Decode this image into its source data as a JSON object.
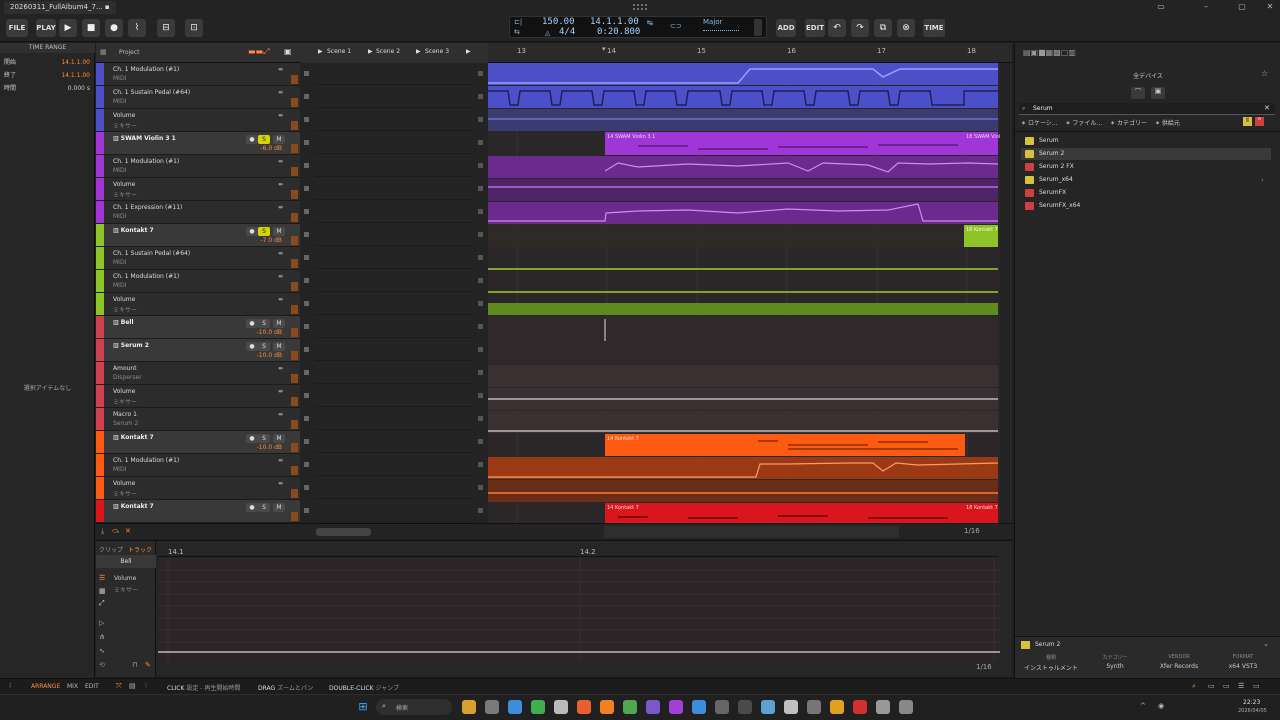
{
  "titlebar": {
    "tab": "20260311_FullAlbum4_7..."
  },
  "toolbar": {
    "file": "FILE",
    "play_label": "PLAY",
    "add": "ADD",
    "edit": "EDIT",
    "time": "TIME",
    "tempo": "150.00",
    "time_sig": "4/4",
    "position": "14.1.1.00",
    "time_position": "0:20.800",
    "key_mode": "Major"
  },
  "inspector": {
    "header": "TIME RANGE",
    "rows": [
      {
        "k": "開始",
        "v": "14.1.1.00"
      },
      {
        "k": "終了",
        "v": "14.1.1.00"
      },
      {
        "k": "時間",
        "v": "0.000 s"
      }
    ],
    "empty": "選択アイテムなし"
  },
  "project_label": "Project",
  "scenes": [
    "Scene 1",
    "Scene 2",
    "Scene 3"
  ],
  "bars": [
    "13",
    "14",
    "15",
    "16",
    "17",
    "18"
  ],
  "tracks": [
    {
      "label": "Ch. 1 Modulation (#1)",
      "sub": "MIDI",
      "type": "auto"
    },
    {
      "label": "Ch. 1 Sustain Pedal (#64)",
      "sub": "MIDI",
      "type": "auto"
    },
    {
      "label": "Volume",
      "sub": "ミキサー",
      "type": "auto"
    },
    {
      "label": "SWAM Violin 3 1",
      "sub": "",
      "type": "main",
      "db": "-6.0 dB"
    },
    {
      "label": "Ch. 1 Modulation (#1)",
      "sub": "MIDI",
      "type": "auto"
    },
    {
      "label": "Volume",
      "sub": "ミキサー",
      "type": "auto"
    },
    {
      "label": "Ch. 1 Expression (#11)",
      "sub": "MIDI",
      "type": "auto"
    },
    {
      "label": "Kontakt 7",
      "sub": "",
      "type": "main",
      "db": "-7.0 dB"
    },
    {
      "label": "Ch. 1 Sustain Pedal (#64)",
      "sub": "MIDI",
      "type": "auto"
    },
    {
      "label": "Ch. 1 Modulation (#1)",
      "sub": "MIDI",
      "type": "auto"
    },
    {
      "label": "Volume",
      "sub": "ミキサー",
      "type": "auto"
    },
    {
      "label": "Bell",
      "sub": "",
      "type": "main",
      "db": "-10.0 dB"
    },
    {
      "label": "Serum 2",
      "sub": "",
      "type": "main",
      "db": "-10.0 dB"
    },
    {
      "label": "Amount",
      "sub": "Disperser",
      "type": "auto"
    },
    {
      "label": "Volume",
      "sub": "ミキサー",
      "type": "auto"
    },
    {
      "label": "Macro 1",
      "sub": "Serum 2",
      "type": "auto"
    },
    {
      "label": "Kontakt 7",
      "sub": "",
      "type": "main",
      "db": "-10.0 dB"
    },
    {
      "label": "Ch. 1 Modulation (#1)",
      "sub": "MIDI",
      "type": "auto"
    },
    {
      "label": "Volume",
      "sub": "ミキサー",
      "type": "auto"
    },
    {
      "label": "Kontakt 7",
      "sub": "",
      "type": "main",
      "db": ""
    }
  ],
  "clips": {
    "swam": "14 SWAM Violin 3 1",
    "swam_end": "18 SWAM Violin 3",
    "kontakt_green": "18 Kontakt 7",
    "kontakt_orange": "14 Kontakt 7",
    "kontakt_red": "14 Kontakt 7",
    "kontakt_red_end": "18 Kontakt 7"
  },
  "arrange_footer": "1/16",
  "editor": {
    "tabs": [
      "クリップ",
      "トラック"
    ],
    "track_name": "Bell",
    "lane_label": "Volume",
    "lane_sub": "ミキサー",
    "ruler": [
      "14.1",
      "14.2"
    ],
    "footer": "1/16"
  },
  "browser": {
    "scope": "全デバイス",
    "search": "Serum",
    "filters": [
      "ロケーシ...",
      "ファイル...",
      "カテゴリー",
      "供給元"
    ],
    "results": [
      {
        "name": "Serum",
        "color": "#d6c23c"
      },
      {
        "name": "Serum 2",
        "color": "#d6c23c"
      },
      {
        "name": "Serum 2 FX",
        "color": "#d04040"
      },
      {
        "name": "Serum_x64",
        "color": "#d6c23c"
      },
      {
        "name": "SerumFX",
        "color": "#d04040"
      },
      {
        "name": "SerumFX_x64",
        "color": "#d04040"
      }
    ],
    "selected_name": "Serum 2",
    "meta": [
      {
        "k": "種類",
        "v": "インストゥルメント"
      },
      {
        "k": "カテゴリー",
        "v": "Synth"
      },
      {
        "k": "VENDOR",
        "v": "Xfer Records"
      },
      {
        "k": "FORMAT",
        "v": "x64 VST3"
      }
    ]
  },
  "status": {
    "modes": [
      "ARRANGE",
      "MIX",
      "EDIT"
    ],
    "hints": [
      {
        "k": "CLICK",
        "v": "設定 - 再生開始時間"
      },
      {
        "k": "DRAG",
        "v": "ズームとパン"
      },
      {
        "k": "DOUBLE-CLICK",
        "v": "ジャンプ"
      }
    ]
  },
  "taskbar": {
    "search": "検索",
    "time": "22:23",
    "date": "2026/04/05"
  }
}
